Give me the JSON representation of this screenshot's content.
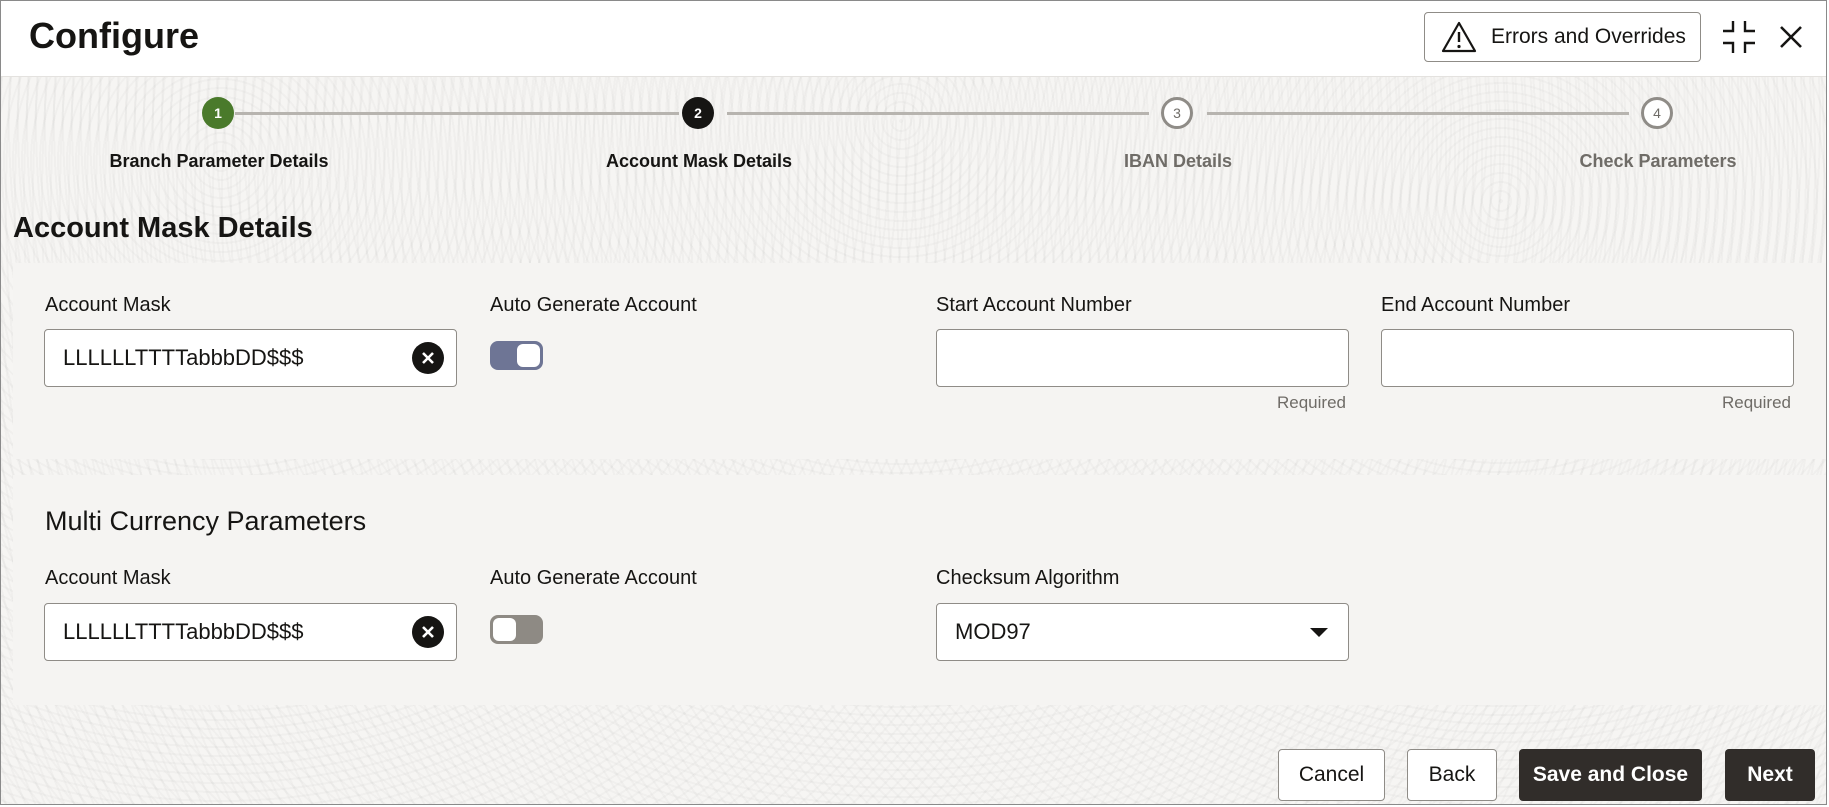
{
  "header": {
    "title": "Configure",
    "errors_button": "Errors and Overrides",
    "icons": [
      "warning-icon",
      "collapse-icon",
      "close-icon"
    ]
  },
  "stepper": {
    "steps": [
      {
        "number": "1",
        "label": "Branch Parameter Details",
        "state": "done"
      },
      {
        "number": "2",
        "label": "Account Mask Details",
        "state": "current"
      },
      {
        "number": "3",
        "label": "IBAN Details",
        "state": "future"
      },
      {
        "number": "4",
        "label": "Check Parameters",
        "state": "future"
      }
    ]
  },
  "account_mask_section": {
    "heading": "Account Mask Details",
    "account_mask_label": "Account Mask",
    "account_mask_value": "LLLLLLTTTTabbbDD$$$",
    "auto_generate_label": "Auto Generate Account",
    "auto_generate_on": true,
    "start_account_label": "Start Account Number",
    "start_account_value": "",
    "start_account_help": "Required",
    "end_account_label": "End Account Number",
    "end_account_value": "",
    "end_account_help": "Required"
  },
  "multi_currency_section": {
    "heading": "Multi Currency Parameters",
    "account_mask_label": "Account Mask",
    "account_mask_value": "LLLLLLTTTTabbbDD$$$",
    "auto_generate_label": "Auto Generate Account",
    "auto_generate_on": false,
    "checksum_label": "Checksum Algorithm",
    "checksum_value": "MOD97"
  },
  "footer": {
    "cancel": "Cancel",
    "back": "Back",
    "save_close": "Save and Close",
    "next": "Next"
  },
  "colors": {
    "step_done": "#4a7a2b",
    "step_current": "#161513",
    "primary_button": "#312d2a",
    "toggle_on": "#6e7595",
    "toggle_off": "#8e8a84"
  }
}
